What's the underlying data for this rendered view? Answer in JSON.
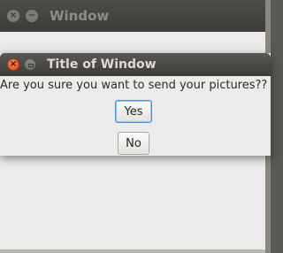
{
  "background_window": {
    "title": "Window",
    "close_glyph": "×",
    "minimize_glyph": "−"
  },
  "dialog": {
    "title": "Title of Window",
    "message": "Are you sure you want to send your pictures??",
    "close_glyph": "×",
    "buttons": {
      "yes_label": "Yes",
      "no_label": "No"
    }
  },
  "colors": {
    "titlebar": "#3c3b37",
    "close_button": "#df4a16",
    "focus_ring": "#4a90d9",
    "window_bg": "#ebebeb"
  }
}
